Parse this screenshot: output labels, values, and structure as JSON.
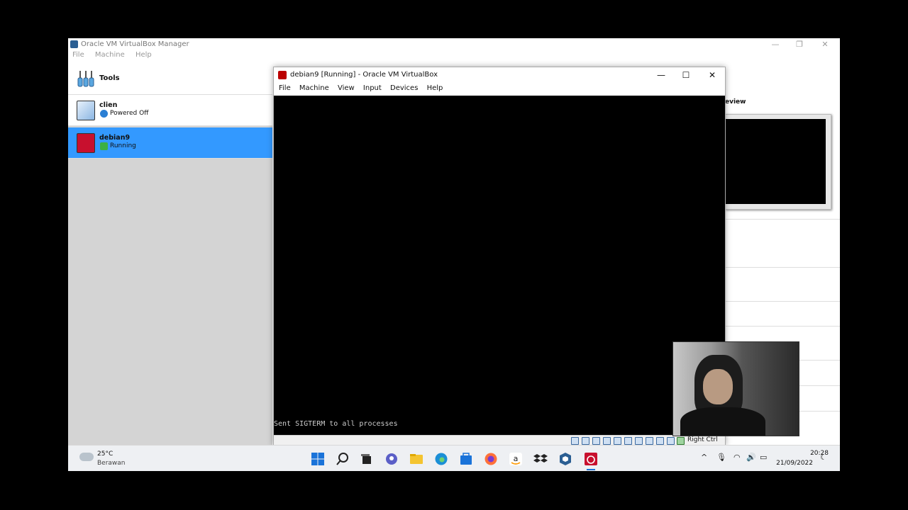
{
  "manager": {
    "title": "Oracle VM VirtualBox Manager",
    "menu": [
      "File",
      "Machine",
      "Help"
    ],
    "tools_label": "Tools",
    "vms": [
      {
        "name": "clien",
        "state": "Powered Off"
      },
      {
        "name": "debian9",
        "state": "Running"
      }
    ],
    "preview_label": "eview"
  },
  "vm_window": {
    "title": "debian9 [Running] - Oracle VM VirtualBox",
    "menu": [
      "File",
      "Machine",
      "View",
      "Input",
      "Devices",
      "Help"
    ],
    "console_text": "Sent SIGTERM to all processes",
    "host_key": "Right Ctrl"
  },
  "taskbar": {
    "weather_temp": "25°C",
    "weather_desc": "Berawan",
    "time": "20:28",
    "date": "21/09/2022"
  },
  "colors": {
    "selection": "#3399ff",
    "console_bg": "#000000",
    "debian_red": "#b00000"
  }
}
